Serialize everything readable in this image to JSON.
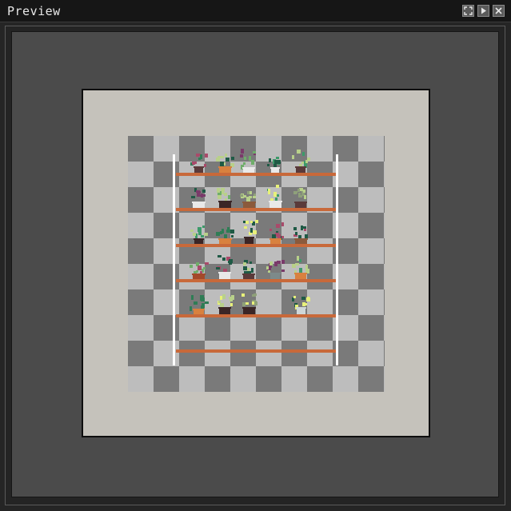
{
  "window": {
    "title": "Preview",
    "buttons": [
      {
        "name": "fullscreen-button",
        "icon": "fullscreen-icon"
      },
      {
        "name": "play-button",
        "icon": "play-icon"
      },
      {
        "name": "close-button",
        "icon": "close-icon"
      }
    ]
  },
  "preview": {
    "checker_colors": [
      "#7a7a7a",
      "#bdbdbd"
    ],
    "canvas_background": "#c5c2bb",
    "shelf_color": "#c8693a",
    "frame_color": "#ffffff",
    "shelf_count": 6,
    "plants_per_shelf": [
      5,
      5,
      5,
      5,
      4
    ]
  }
}
